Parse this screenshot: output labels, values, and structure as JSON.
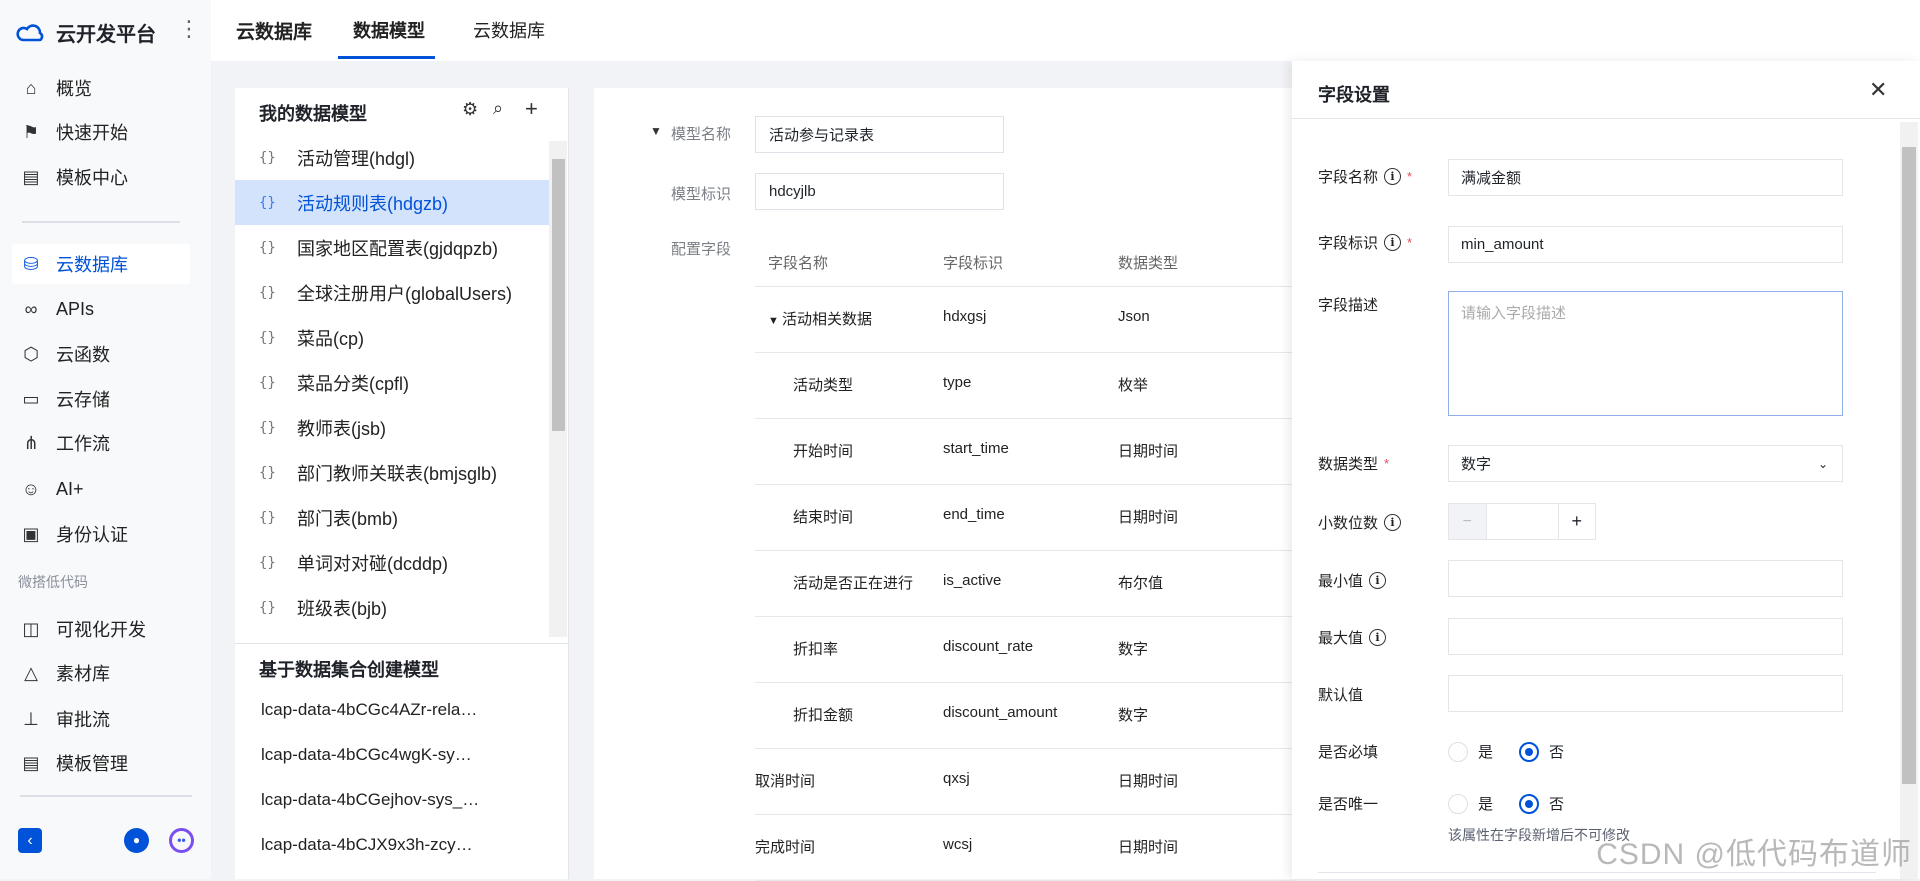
{
  "app": {
    "name": "云开发平台"
  },
  "sidebar": {
    "items": [
      {
        "label": "概览",
        "icon": "home-icon"
      },
      {
        "label": "快速开始",
        "icon": "flag-icon"
      },
      {
        "label": "模板中心",
        "icon": "template-icon"
      },
      {
        "label": "云数据库",
        "icon": "database-icon",
        "active": true
      },
      {
        "label": "APIs",
        "icon": "link-icon"
      },
      {
        "label": "云函数",
        "icon": "function-icon"
      },
      {
        "label": "云存储",
        "icon": "folder-icon"
      },
      {
        "label": "工作流",
        "icon": "workflow-icon"
      },
      {
        "label": "AI+",
        "icon": "robot-icon"
      },
      {
        "label": "身份认证",
        "icon": "id-card-icon"
      },
      {
        "label": "可视化开发",
        "icon": "layout-icon"
      },
      {
        "label": "素材库",
        "icon": "shapes-icon"
      },
      {
        "label": "审批流",
        "icon": "stamp-icon"
      },
      {
        "label": "模板管理",
        "icon": "template-icon"
      }
    ],
    "section": "微搭低代码"
  },
  "topbar": {
    "title": "云数据库",
    "tabs": [
      "数据模型",
      "云数据库"
    ],
    "active_tab": "数据模型"
  },
  "models": {
    "title": "我的数据模型",
    "items": [
      "活动管理(hdgl)",
      "活动规则表(hdgzb)",
      "国家地区配置表(gjdqpzb)",
      "全球注册用户(globalUsers)",
      "菜品(cp)",
      "菜品分类(cpfl)",
      "教师表(jsb)",
      "部门教师关联表(bmjsglb)",
      "部门表(bmb)",
      "单词对对碰(dcddp)",
      "班级表(bjb)"
    ],
    "selected": "活动规则表(hdgzb)",
    "dataset_title": "基于数据集合创建模型",
    "dataset_items": [
      "lcap-data-4bCGc4AZr-rela…",
      "lcap-data-4bCGc4wgK-sy…",
      "lcap-data-4bCGejhov-sys_…",
      "lcap-data-4bCJX9x3h-zcy…"
    ]
  },
  "form": {
    "name_label": "模型名称",
    "name_value": "活动参与记录表",
    "id_label": "模型标识",
    "id_value": "hdcyjlb",
    "fields_label": "配置字段",
    "columns": [
      "字段名称",
      "字段标识",
      "数据类型"
    ],
    "rows": [
      {
        "name": "活动相关数据",
        "id": "hdxgsj",
        "type": "Json",
        "level": 0,
        "expanded": true
      },
      {
        "name": "活动类型",
        "id": "type",
        "type": "枚举",
        "level": 1
      },
      {
        "name": "开始时间",
        "id": "start_time",
        "type": "日期时间",
        "level": 1
      },
      {
        "name": "结束时间",
        "id": "end_time",
        "type": "日期时间",
        "level": 1
      },
      {
        "name": "活动是否正在进行",
        "id": "is_active",
        "type": "布尔值",
        "level": 1
      },
      {
        "name": "折扣率",
        "id": "discount_rate",
        "type": "数字",
        "level": 1
      },
      {
        "name": "折扣金额",
        "id": "discount_amount",
        "type": "数字",
        "level": 1
      },
      {
        "name": "取消时间",
        "id": "qxsj",
        "type": "日期时间",
        "level": 0
      },
      {
        "name": "完成时间",
        "id": "wcsj",
        "type": "日期时间",
        "level": 0
      }
    ]
  },
  "drawer": {
    "title": "字段设置",
    "field_name_label": "字段名称",
    "field_name_value": "满减金额",
    "field_id_label": "字段标识",
    "field_id_value": "min_amount",
    "desc_label": "字段描述",
    "desc_placeholder": "请输入字段描述",
    "type_label": "数据类型",
    "type_value": "数字",
    "decimal_label": "小数位数",
    "decimal_value": "",
    "minus": "−",
    "plus": "+",
    "min_label": "最小值",
    "max_label": "最大值",
    "default_label": "默认值",
    "required_label": "是否必填",
    "unique_label": "是否唯一",
    "yes": "是",
    "no": "否",
    "required_value": "否",
    "unique_value": "否",
    "unique_hint": "该属性在字段新增后不可修改"
  },
  "watermark": "CSDN @低代码布道师",
  "colors": {
    "accent": "#0052d9",
    "selected_bg": "#d4e3fc"
  }
}
